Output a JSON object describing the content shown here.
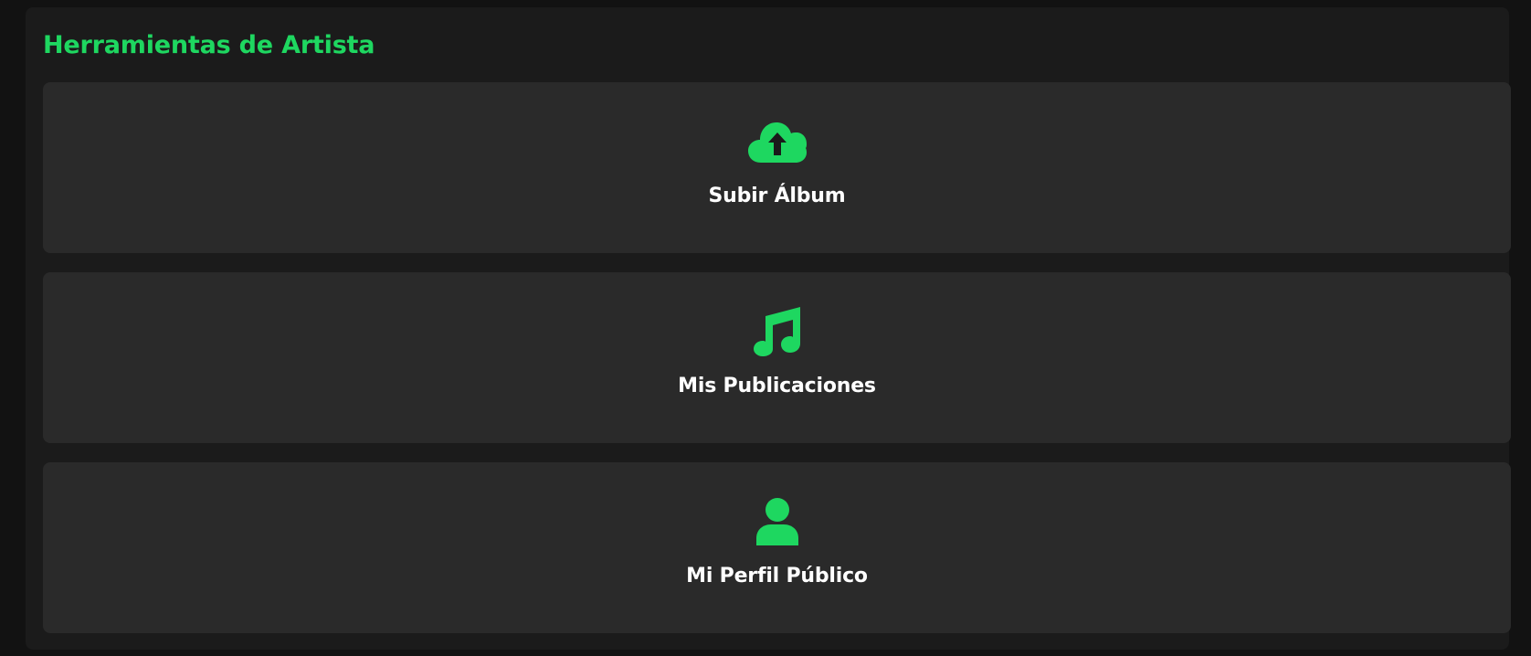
{
  "panel": {
    "title": "Herramientas de Artista"
  },
  "cards": [
    {
      "label": "Subir Álbum",
      "icon": "cloud-upload-icon"
    },
    {
      "label": "Mis Publicaciones",
      "icon": "music-note-icon"
    },
    {
      "label": "Mi Perfil Público",
      "icon": "user-icon"
    }
  ],
  "colors": {
    "accent": "#1ed760",
    "page_background": "#121212",
    "panel_background": "#1b1b1b",
    "card_background": "#2a2a2a",
    "label_text": "#ffffff"
  }
}
